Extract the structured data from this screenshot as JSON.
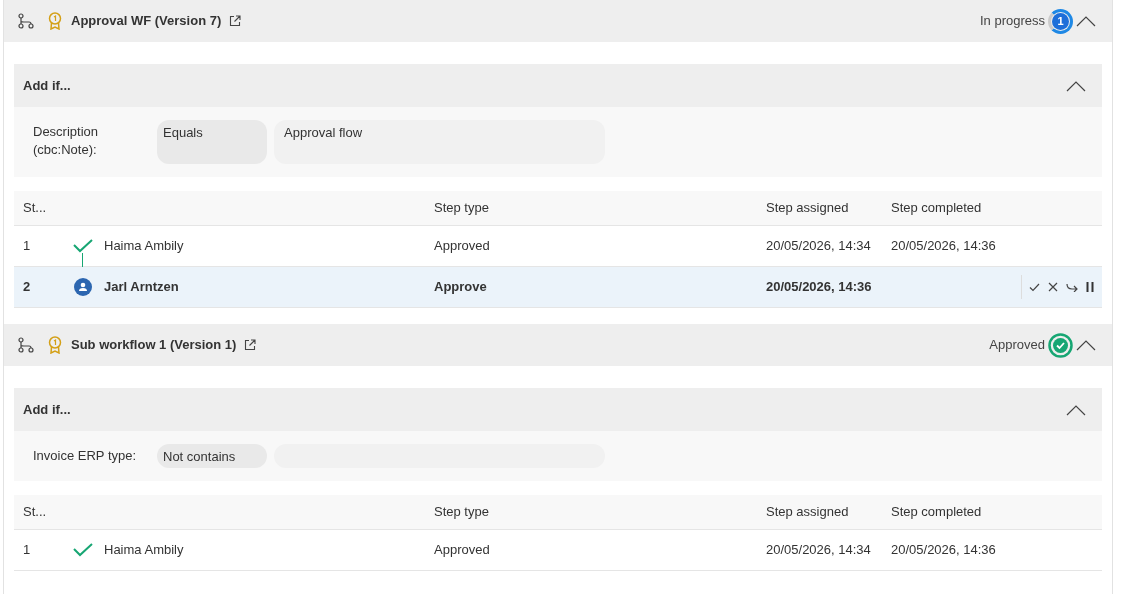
{
  "workflows": [
    {
      "title": "Approval WF (Version 7)",
      "status": {
        "kind": "in_progress",
        "label": "In progress",
        "count": "1"
      },
      "expanded": true,
      "condition_group": {
        "title": "Add if...",
        "expanded": true,
        "conditions": [
          {
            "label": "Description (cbc:Note):",
            "operator": "Equals",
            "value": "Approval flow"
          }
        ]
      },
      "columns": [
        "St...",
        "Step type",
        "Step assigned",
        "Step completed"
      ],
      "rows": [
        {
          "step": "1",
          "kind": "done",
          "name": "Haima Ambily",
          "step_type": "Approved",
          "assigned": "20/05/2026, 14:34",
          "completed": "20/05/2026, 14:36",
          "selected": false
        },
        {
          "step": "2",
          "kind": "current",
          "name": "Jarl Arntzen",
          "step_type": "Approve",
          "assigned": "20/05/2026, 14:36",
          "selected": true
        }
      ]
    },
    {
      "title": "Sub workflow 1 (Version 1)",
      "status": {
        "kind": "approved",
        "label": "Approved"
      },
      "expanded": true,
      "condition_group": {
        "title": "Add if...",
        "expanded": true,
        "conditions": [
          {
            "label": "Invoice ERP type:",
            "operator": "Not contains"
          }
        ]
      },
      "columns": [
        "St...",
        "Step type",
        "Step assigned",
        "Step completed"
      ],
      "rows": [
        {
          "step": "1",
          "kind": "done",
          "name": "Haima Ambily",
          "step_type": "Approved",
          "assigned": "20/05/2026, 14:34",
          "completed": "20/05/2026, 14:36",
          "selected": false
        }
      ]
    }
  ]
}
